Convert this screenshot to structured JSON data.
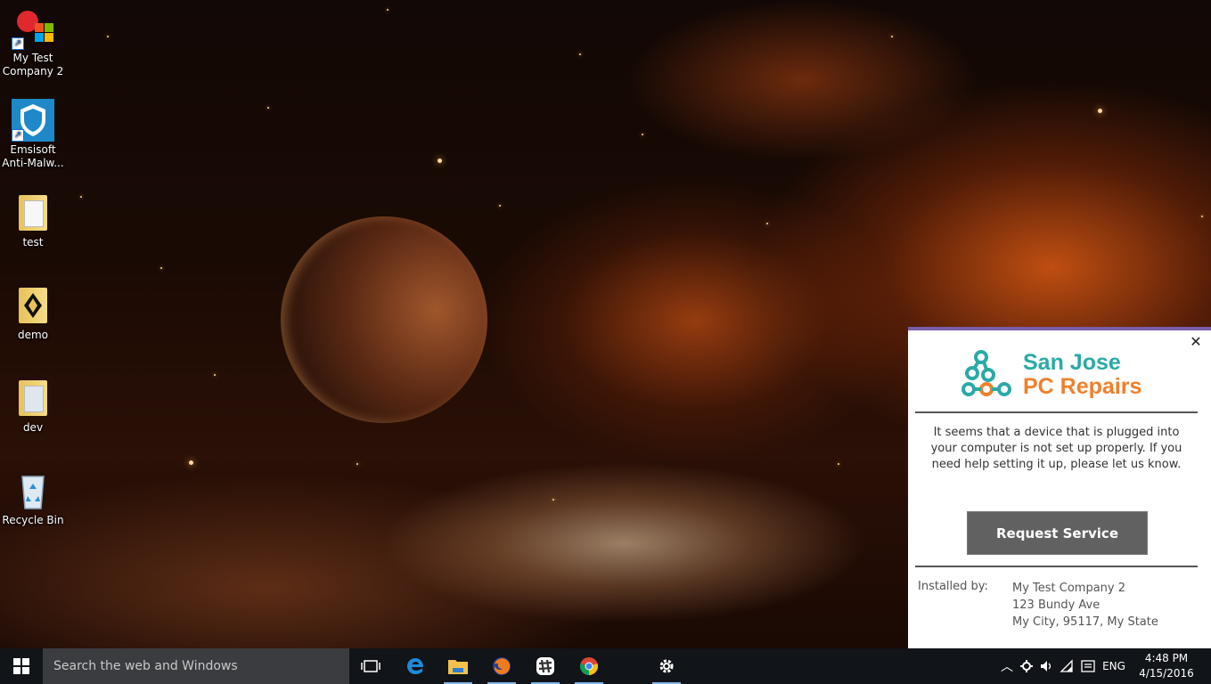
{
  "desktop": {
    "icons": [
      {
        "label_line1": "My Test",
        "label_line2": "Company 2"
      },
      {
        "label_line1": "Emsisoft",
        "label_line2": "Anti-Malw..."
      },
      {
        "label_line1": "test"
      },
      {
        "label_line1": "demo"
      },
      {
        "label_line1": "dev"
      },
      {
        "label_line1": "Recycle Bin"
      }
    ]
  },
  "popup": {
    "brand_line1": "San Jose",
    "brand_line2": "PC Repairs",
    "message": "It seems that a device that is plugged into your computer is not set up properly. If you need help setting it up, please let us know.",
    "button_label": "Request Service",
    "installed_by_label": "Installed by:",
    "installer": {
      "name": "My Test Company 2",
      "address": "123 Bundy Ave",
      "city": "My City, 95117, My State"
    },
    "colors": {
      "accent_bar": "#7a5ca8",
      "brand_teal": "#2aaaa6",
      "brand_orange": "#f0802c",
      "button": "#616161"
    }
  },
  "taskbar": {
    "search_placeholder": "Search the web and Windows",
    "apps": [
      "task-view-icon",
      "edge-icon",
      "file-explorer-icon",
      "firefox-icon",
      "slack-icon",
      "chrome-icon",
      "settings-icon"
    ],
    "tray": {
      "language": "ENG",
      "time": "4:48 PM",
      "date": "4/15/2016"
    }
  }
}
